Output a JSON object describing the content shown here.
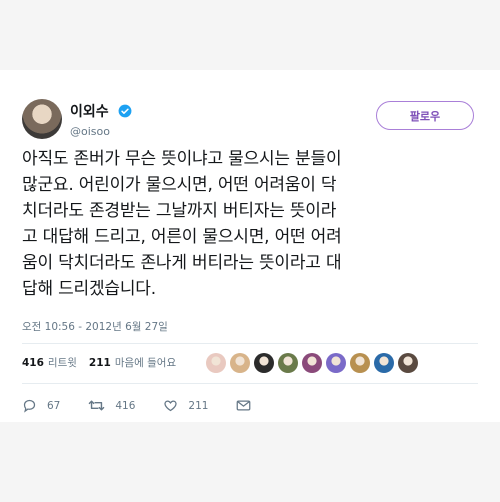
{
  "user": {
    "display_name": "이외수",
    "handle": "@oisoo"
  },
  "follow_button": {
    "label": "팔로우"
  },
  "tweet": {
    "text": "아직도 존버가 무슨 뜻이냐고 물으시는 분들이\n많군요. 어린이가 물으시면, 어떤 어려움이 닥\n치더라도 존경받는 그날까지 버티자는 뜻이라\n고 대답해 드리고, 어른이 물으시면, 어떤 어려\n움이 닥치더라도 존나게 버티라는 뜻이라고 대\n답해 드리겠습니다.",
    "timestamp": "오전 10:56 - 2012년 6월 27일"
  },
  "stats": {
    "retweets_count": "416",
    "retweets_label": "리트윗",
    "likes_count": "211",
    "likes_label": "마음에 들어요"
  },
  "likers": [
    {
      "color": "#e9c9c0"
    },
    {
      "color": "#d8b48a"
    },
    {
      "color": "#2b2b2b"
    },
    {
      "color": "#6a7a4a"
    },
    {
      "color": "#8a4a7a"
    },
    {
      "color": "#7a6ac8"
    },
    {
      "color": "#b89050"
    },
    {
      "color": "#2a6aa8"
    },
    {
      "color": "#5a4a40"
    }
  ],
  "actions": {
    "reply_count": "67",
    "retweet_count": "416",
    "like_count": "211"
  },
  "colors": {
    "accent": "#7e50b8",
    "verified": "#1da1f2",
    "muted": "#657786"
  }
}
